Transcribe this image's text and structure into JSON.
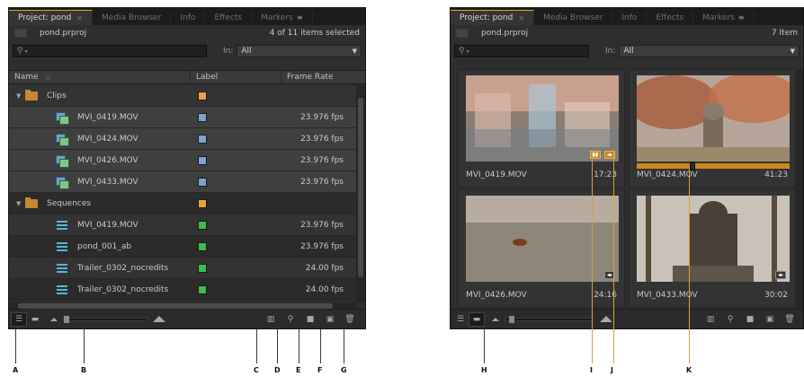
{
  "left_panel": {
    "tabs": [
      {
        "label": "Project: pond",
        "active": true
      },
      {
        "label": "Media Browser"
      },
      {
        "label": "Info"
      },
      {
        "label": "Effects"
      },
      {
        "label": "Markers"
      }
    ],
    "project_file": "pond.prproj",
    "selection_count": "4 of 11 items selected",
    "search_placeholder": "",
    "in_label": "In:",
    "in_value": "All",
    "columns": {
      "name": "Name",
      "label": "Label",
      "rate": "Frame Rate"
    },
    "rows": [
      {
        "type": "folder",
        "name": "Clips",
        "label_color": "#e8a33a",
        "rate": ""
      },
      {
        "type": "clip",
        "name": "MVI_0419.MOV",
        "label_color": "#7ea2d6",
        "rate": "23.976 fps"
      },
      {
        "type": "clip",
        "name": "MVI_0424.MOV",
        "label_color": "#7ea2d6",
        "rate": "23.976 fps"
      },
      {
        "type": "clip",
        "name": "MVI_0426.MOV",
        "label_color": "#7ea2d6",
        "rate": "23.976 fps"
      },
      {
        "type": "clip",
        "name": "MVI_0433.MOV",
        "label_color": "#7ea2d6",
        "rate": "23.976 fps"
      },
      {
        "type": "folder",
        "name": "Sequences",
        "label_color": "#e8a33a",
        "rate": ""
      },
      {
        "type": "seq",
        "name": "MVI_0419.MOV",
        "label_color": "#3fbb4f",
        "rate": "23.976 fps"
      },
      {
        "type": "seq",
        "name": "pond_001_ab",
        "label_color": "#3fbb4f",
        "rate": "23.976 fps"
      },
      {
        "type": "seq",
        "name": "Trailer_0302_nocredits",
        "label_color": "#3fbb4f",
        "rate": "24.00 fps"
      },
      {
        "type": "seq",
        "name": "Trailer_0302_nocredits",
        "label_color": "#3fbb4f",
        "rate": "24.00 fps"
      }
    ]
  },
  "right_panel": {
    "tabs": [
      {
        "label": "Project: pond",
        "active": true
      },
      {
        "label": "Media Browser"
      },
      {
        "label": "Info"
      },
      {
        "label": "Effects"
      },
      {
        "label": "Markers"
      }
    ],
    "project_file": "pond.prproj",
    "item_count": "7 Item",
    "in_label": "In:",
    "in_value": "All",
    "clips": [
      {
        "name": "MVI_0419.MOV",
        "duration": "17:23",
        "scene": "water-reflection"
      },
      {
        "name": "MVI_0424.MOV",
        "duration": "41:23",
        "scene": "autumn-tree-statue",
        "scrub_level": 0.36
      },
      {
        "name": "MVI_0426.MOV",
        "duration": "24:16",
        "scene": "pond-turtle"
      },
      {
        "name": "MVI_0433.MOV",
        "duration": "30:02",
        "scene": "stone-statue"
      }
    ]
  },
  "callout_labels": [
    "A",
    "B",
    "C",
    "D",
    "E",
    "F",
    "G",
    "H",
    "I",
    "J",
    "K"
  ]
}
